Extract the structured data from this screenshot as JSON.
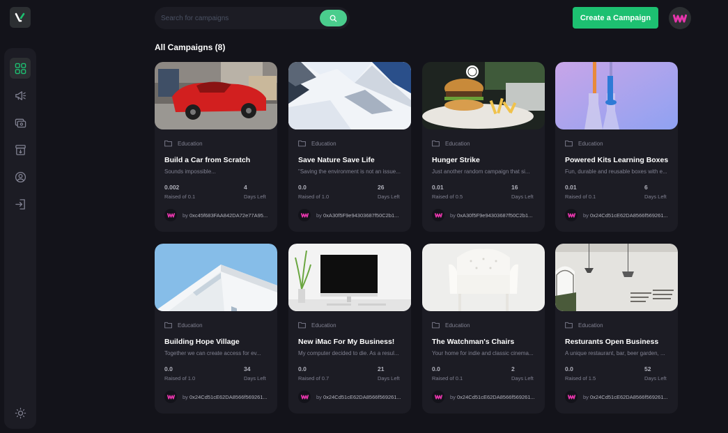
{
  "search": {
    "placeholder": "Search for campaigns"
  },
  "header": {
    "create_label": "Create a Campaign"
  },
  "page": {
    "title": "All Campaigns (8)"
  },
  "sidebar": {
    "items": [
      {
        "icon": "dashboard-icon",
        "active": true
      },
      {
        "icon": "campaign-icon",
        "active": false
      },
      {
        "icon": "payment-icon",
        "active": false
      },
      {
        "icon": "withdraw-icon",
        "active": false
      },
      {
        "icon": "profile-icon",
        "active": false
      },
      {
        "icon": "logout-icon",
        "active": false
      }
    ],
    "theme_icon": "sun-icon"
  },
  "colors": {
    "accent": "#1dc071",
    "search_button": "#4acd8d",
    "card_bg": "#1c1c24",
    "page_bg": "#13131a"
  },
  "campaigns": [
    {
      "category": "Education",
      "title": "Build a Car from Scratch",
      "description": "Sounds impossible...",
      "raised": "0.002",
      "raised_label": "Raised of 0.1",
      "days": "4",
      "days_label": "Days Left",
      "owner_prefix": "by",
      "owner": "0xc45f683FAA842DA72e77A95..."
    },
    {
      "category": "Education",
      "title": "Save Nature Save Life",
      "description": "\"Saving the environment is not an issue...",
      "raised": "0.0",
      "raised_label": "Raised of 1.0",
      "days": "26",
      "days_label": "Days Left",
      "owner_prefix": "by",
      "owner": "0xA30f5F9e94303687f50C2b1..."
    },
    {
      "category": "Education",
      "title": "Hunger Strike",
      "description": "Just another random campaign that si...",
      "raised": "0.01",
      "raised_label": "Raised of 0.5",
      "days": "16",
      "days_label": "Days Left",
      "owner_prefix": "by",
      "owner": "0xA30f5F9e94303687f50C2b1..."
    },
    {
      "category": "Education",
      "title": "Powered Kits Learning Boxes",
      "description": "Fun, durable and reusable boxes with e...",
      "raised": "0.01",
      "raised_label": "Raised of 0.1",
      "days": "6",
      "days_label": "Days Left",
      "owner_prefix": "by",
      "owner": "0x24Cd51cE62DA8566f569261..."
    },
    {
      "category": "Education",
      "title": "Building Hope Village",
      "description": "Together we can create access for ev...",
      "raised": "0.0",
      "raised_label": "Raised of 1.0",
      "days": "34",
      "days_label": "Days Left",
      "owner_prefix": "by",
      "owner": "0x24Cd51cE62DA8566f569261..."
    },
    {
      "category": "Education",
      "title": "New iMac For My Business!",
      "description": "My computer decided to die. As a resul...",
      "raised": "0.0",
      "raised_label": "Raised of 0.7",
      "days": "21",
      "days_label": "Days Left",
      "owner_prefix": "by",
      "owner": "0x24Cd51cE62DA8566f569261..."
    },
    {
      "category": "Education",
      "title": "The Watchman's Chairs",
      "description": "Your home for indie and classic cinema...",
      "raised": "0.0",
      "raised_label": "Raised of 0.1",
      "days": "2",
      "days_label": "Days Left",
      "owner_prefix": "by",
      "owner": "0x24Cd51cE62DA8566f569261..."
    },
    {
      "category": "Education",
      "title": "Resturants Open Business",
      "description": "A unique restaurant, bar, beer garden, ...",
      "raised": "0.0",
      "raised_label": "Raised of 1.5",
      "days": "52",
      "days_label": "Days Left",
      "owner_prefix": "by",
      "owner": "0x24Cd51cE62DA8566f569261..."
    }
  ]
}
